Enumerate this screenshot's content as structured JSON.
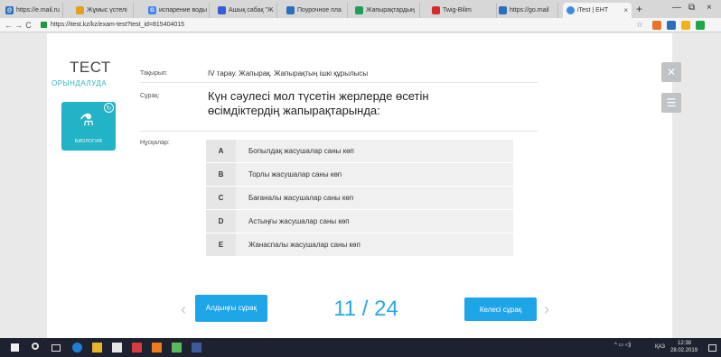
{
  "browser": {
    "tabs": [
      {
        "label": "https://e.mail.ru",
        "color": "#2a6ebd"
      },
      {
        "label": "Жұмыс үстелі",
        "color": "#e0a020"
      },
      {
        "label": "испарение воды",
        "color": "#4285f4"
      },
      {
        "label": "Ашық сабақ \"Ж",
        "color": "#3b5bd6"
      },
      {
        "label": "Поурочное пла",
        "color": "#2a6ebd"
      },
      {
        "label": "Жапырақтардың",
        "color": "#1f9e5a"
      },
      {
        "label": "Twig-Bilim",
        "color": "#d62b2b"
      },
      {
        "label": "https://go.mail",
        "color": "#2a6ebd"
      },
      {
        "label": "iTest | ЕНТ",
        "color": "#3c8be0",
        "active": true
      }
    ],
    "url": "https://itest.kz/kz/exam-test?test_id=815404015",
    "new_tab": "+",
    "win_min": "—",
    "win_restore": "⧉",
    "win_close": "×"
  },
  "sidebar": {
    "title": "ТЕСТ",
    "subtitle": "ОРЫНДАЛУДА",
    "subject_label": "БИОЛОГИЯ"
  },
  "test": {
    "topic_label": "Тақырып:",
    "topic": "IV тарау. Жапырақ. Жапырақтың ішкі құрылысы",
    "question_label": "Сұрақ:",
    "question": "Күн сәулесі мол түсетін жерлерде өсетін өсімдіктердің жапырақтарында:",
    "options_label": "Нұсқалар:",
    "options": [
      {
        "letter": "A",
        "text": "Бопылдақ жасушалар саны көп"
      },
      {
        "letter": "B",
        "text": "Торлы жасушалар саны көп"
      },
      {
        "letter": "C",
        "text": "Бағаналы жасушалар саны көп"
      },
      {
        "letter": "D",
        "text": "Астыңғы жасушалар саны көп"
      },
      {
        "letter": "E",
        "text": "Жанаспалы жасушалар саны көп"
      }
    ],
    "prev_label": "Алдыңғы сұрақ",
    "next_label": "Келесі сұрақ",
    "counter": "11 / 24"
  },
  "taskbar": {
    "lang": "ҚАЗ",
    "time": "12:38",
    "date": "28.02.2019"
  }
}
